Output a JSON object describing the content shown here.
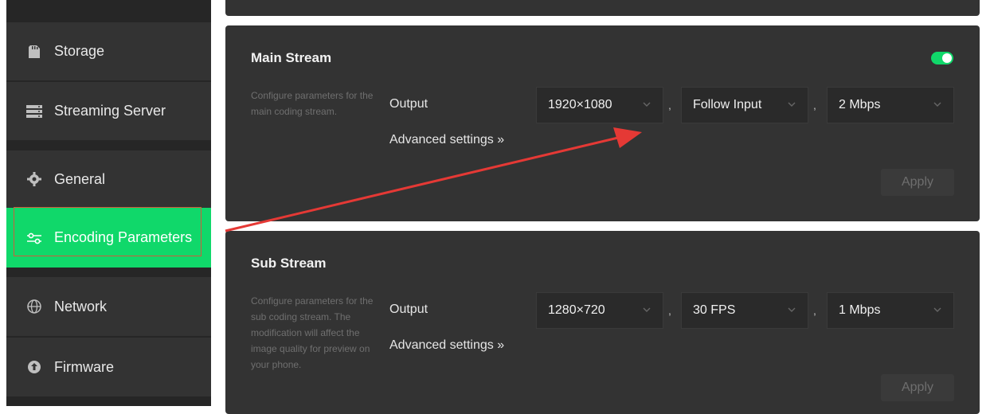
{
  "sidebar": {
    "items": [
      {
        "label": "Storage",
        "icon": "sd-card-icon"
      },
      {
        "label": "Streaming Server",
        "icon": "server-icon"
      },
      {
        "label": "General",
        "icon": "gear-icon"
      },
      {
        "label": "Encoding Parameters",
        "icon": "sliders-icon",
        "active": true
      },
      {
        "label": "Network",
        "icon": "globe-icon"
      },
      {
        "label": "Firmware",
        "icon": "upload-icon"
      }
    ]
  },
  "main_stream": {
    "title": "Main Stream",
    "enabled": true,
    "description": "Configure parameters for the main coding stream.",
    "output_label": "Output",
    "resolution": "1920×1080",
    "frame_rate": "Follow Input",
    "bitrate": "2 Mbps",
    "advanced": "Advanced settings »",
    "apply": "Apply"
  },
  "sub_stream": {
    "title": "Sub Stream",
    "description": "Configure parameters for the sub coding stream. The modification will affect the image quality for preview on your phone.",
    "output_label": "Output",
    "resolution": "1280×720",
    "frame_rate": "30 FPS",
    "bitrate": "1 Mbps",
    "advanced": "Advanced settings »",
    "apply": "Apply"
  },
  "separators": [
    ",",
    ","
  ],
  "colors": {
    "accent": "#10d86a",
    "panel": "#333333",
    "annotation_arrow": "#e53935"
  }
}
